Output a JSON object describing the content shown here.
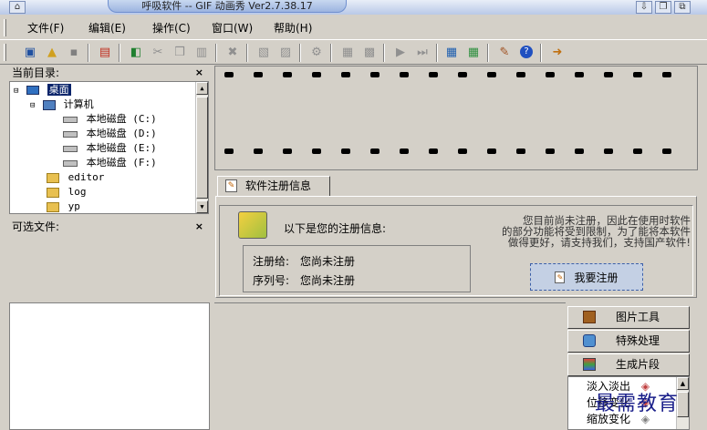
{
  "window": {
    "title": "呼吸软件 -- GIF 动画秀 Ver2.7.38.17"
  },
  "menu": [
    "文件(F)",
    "编辑(E)",
    "操作(C)",
    "窗口(W)",
    "帮助(H)"
  ],
  "panels": {
    "current_dir": {
      "title": "当前目录:"
    },
    "selectable_files": {
      "title": "可选文件:"
    }
  },
  "tree": {
    "desktop": "桌面",
    "computer": "计算机",
    "drives": [
      "本地磁盘 (C:)",
      "本地磁盘 (D:)",
      "本地磁盘 (E:)",
      "本地磁盘 (F:)"
    ],
    "folders": [
      "editor",
      "log",
      "yp"
    ]
  },
  "register": {
    "tab_label": "软件注册信息",
    "intro": "以下是您的注册信息:",
    "registered_to_label": "注册给:",
    "registered_to_value": "您尚未注册",
    "serial_label": "序列号:",
    "serial_value": "您尚未注册",
    "notice_line1": "您目前尚未注册，因此在使用时软件",
    "notice_line2": "的部分功能将受到限制，为了能将本软件",
    "notice_line3": "做得更好，请支持我们，支持国产软件!",
    "button_label": "我要注册"
  },
  "options": {
    "picture_tools": "图片工具",
    "special_processing": "特殊处理",
    "generate_segment": "生成片段",
    "effects": [
      "淡入淡出",
      "位移变化",
      "缩放变化"
    ]
  },
  "watermark": "最需教育",
  "colors": {
    "selection": "#0a246a",
    "accent": "#3c5fa8"
  }
}
